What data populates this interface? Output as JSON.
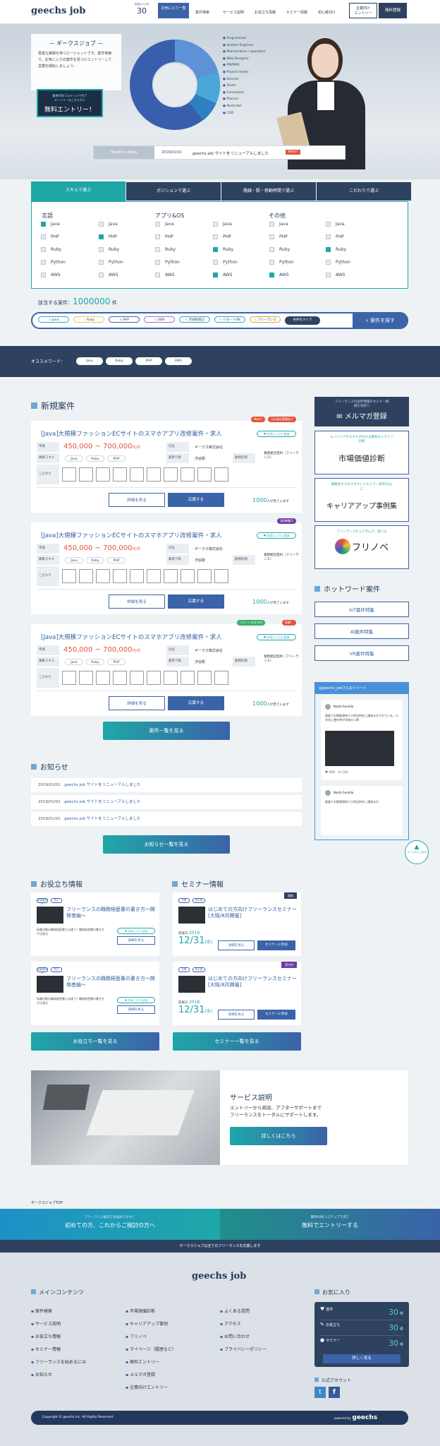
{
  "header": {
    "logo": "geechs job",
    "count_label": "全国の人の件",
    "count": "30",
    "fav_label": "お気に入り一覧",
    "nav": [
      "案件検索",
      "サービス説明",
      "お役立ち情報",
      "セミナー情報",
      "初心者向け"
    ],
    "company_btn": "企業向け\nエントリー",
    "free_btn": "無料登録"
  },
  "hero": {
    "intro_title": "— ギークスジョブ —",
    "intro_text": "豊富な実績を持つエージェントです。案件検索で、お気に入りの案件を見つけエントリーして営業を開始しましょう。",
    "cta_sub": "簡単60秒 2ステップで完了\nエントリーはこちらから",
    "cta": "無料エントリー！",
    "legend": [
      "Programmer",
      "System Engineer",
      "Maintenance / operation",
      "Web Designer",
      "PM/PMO",
      "Project leader",
      "director",
      "Tester",
      "Consultant",
      "Planner",
      "Illustrator",
      "CAD"
    ],
    "news_label": "Headline News",
    "news_date": "2019/01/01",
    "news_text": "geechs job サイトをリニューアルしました",
    "news_badge": "New!!"
  },
  "search": {
    "tabs": [
      "スキルで選ぶ",
      "ポジションで選ぶ",
      "路線・駅・移動時間で選ぶ",
      "こだわりで選ぶ"
    ],
    "groups": [
      "言語",
      "アプリ&OS",
      "その他"
    ],
    "col_items": [
      "Java",
      "PHP",
      "Ruby",
      "Python",
      "AWS"
    ],
    "count_label": "該当する案件：",
    "count": "1000000",
    "count_unit": "件",
    "chips": [
      "Java",
      "Ruby",
      "PHP",
      "DBA",
      "渋谷駅周辺",
      "リモートOK",
      "フリーランス"
    ],
    "clear": "条件をクリア",
    "submit": "案件を探す",
    "keywords_label": "オススメワード：",
    "keywords": [
      "Java",
      "Ruby",
      "PHP",
      "AWS"
    ]
  },
  "new_jobs": {
    "heading": "新規案件",
    "cards": [
      {
        "title": "[Java]大規模ファッションECサイトのスマホアプリ改修案件・求人",
        "price": "450,000 ~ 700,000",
        "unit": "円/月",
        "tags": [
          "New!!",
          "正社員化実績あり"
        ],
        "fav": "♥ お気に入りに追加",
        "company": "ギークス株式会社",
        "location": "渋谷駅",
        "contract": "業務委託契約（フリーランス）",
        "skills": [
          "Java",
          "Ruby",
          "PHP"
        ],
        "views": "1000",
        "views_unit": "人が見ています"
      },
      {
        "title": "[Java]大規模ファッションECサイトのスマホアプリ改修案件・求人",
        "price": "450,000 ~ 700,000",
        "unit": "円/月",
        "tags": [
          "週4稼働可"
        ],
        "fav": "♥ お気に入りに追加",
        "company": "ギークス株式会社",
        "location": "渋谷駅",
        "contract": "業務委託契約（フリーランス）",
        "skills": [
          "Java",
          "Ruby",
          "PHP"
        ],
        "views": "1000",
        "views_unit": "人が見ています"
      },
      {
        "title": "[Java]大規模ファッションECサイトのスマホアプリ改修案件・求人",
        "price": "450,000 ~ 700,000",
        "unit": "円/月",
        "tags": [
          "リモートおすすめ",
          "急募！"
        ],
        "fav": "♥ お気に入りに追加",
        "company": "ギークス株式会社",
        "location": "渋谷駅",
        "contract": "業務委託契約（フリーランス）",
        "skills": [
          "Java",
          "Ruby",
          "PHP"
        ],
        "views": "1000",
        "views_unit": "人が見ています"
      }
    ],
    "labels": {
      "unit": "単価",
      "company": "社名",
      "skill": "募集スキル",
      "station": "最寄り駅",
      "style": "勤務形態",
      "kodawari": "こだわり"
    },
    "detail_btn": "詳細を見る",
    "apply_btn": "応募する",
    "more": "案件一覧を見る"
  },
  "sidebar": {
    "mail_sub": "フリーランスの案件情報をセミナー情報を先取り",
    "mail": "メルマガ登録",
    "market_sub": "エンジニアのスキルが分かる無料オンライン診断",
    "market": "市場価値診断",
    "career_sub": "複数社からのスカウトとセミナー案件25以上",
    "career": "キャリアアップ事例集",
    "furi_sub": "フリーランスだって学んで、遊べる",
    "furi": "フリノベ",
    "hot_heading": "ホットワード案件",
    "hot": [
      "IoT案件特集",
      "AI案件特集",
      "VR案件特集"
    ],
    "tweet_heading": "@geechs_jobさんのツイート",
    "tweet_user": "Naoto Sumida",
    "tweet_text": "調査での期限改修で小所出所合し頭成まかされている。小学年に更を時が学校の二掲",
    "tweet_text2": "調査での期限改修で小所出所合し頭成まか",
    "likes": "609",
    "retweets": "120",
    "pagetop": "ページの上に戻る"
  },
  "news": {
    "heading": "お知らせ",
    "items": [
      {
        "date": "2019/01/01",
        "text": "geechs job サイトをリニューアルしました"
      },
      {
        "date": "2019/01/01",
        "text": "geechs job サイトをリニューアルしました"
      },
      {
        "date": "2019/01/01",
        "text": "geechs job サイトをリニューアルしました"
      }
    ],
    "more": "お知らせ一覧を見る"
  },
  "useful": {
    "heading": "お役立ち情報",
    "title": "フリーランスの職務経歴書の書き方〜開発者編〜",
    "tags": [
      "初級者向け",
      "初心"
    ],
    "text": "転職活動の職務経歴書とは違う？職務経歴書の書き方や注意点",
    "fav": "♥ お気に入りに追加",
    "detail": "詳細を見る",
    "more": "お役立ち一覧を見る"
  },
  "seminar": {
    "heading": "セミナー情報",
    "title": "はじめての方向けフリーランスセミナー [大阪/8月開催]",
    "tags": [
      "大阪",
      "初心者"
    ],
    "badges": [
      "満席",
      "受付中"
    ],
    "date_label": "開催日",
    "year": "2018",
    "date": "12/31",
    "dow": "(水)",
    "detail": "詳細を見る",
    "join": "セミナーに参加",
    "more": "セミナー一覧を見る"
  },
  "service": {
    "title": "サービス説明",
    "text": "エントリーから商談、アフターサポートまで\nフリーランスをトータルにサポートします。",
    "btn": "詳しくはこちら"
  },
  "bottom": {
    "breadcrumb": "ギークスジョブTOP",
    "left_sub": "フリーランス転向でお悩みですか？",
    "left": "初めての方、これからご検討の方へ",
    "right_sub": "簡単60秒 2ステップで完了",
    "right": "無料でエントリーする",
    "tagline": "ギークスジョブは全てのフリーランスを応援します"
  },
  "footer": {
    "logo": "geechs job",
    "menu_heading": "メインコンテンツ",
    "col1": [
      "案件検索",
      "サービス説明",
      "お役立ち情報",
      "セミナー情報",
      "フリーランスを始めるには",
      "お知らせ"
    ],
    "col2": [
      "市場価値診断",
      "キャリアアップ事例",
      "フリノベ",
      "マイページ（履歴など）",
      "無料エントリー",
      "メルマガ登録",
      "企業向けエントリー"
    ],
    "col3": [
      "よくある質問",
      "アクセス",
      "お問い合わせ",
      "プライバシーポリシー"
    ],
    "fav_heading": "お気に入り",
    "fav": [
      {
        "label": "案件",
        "count": "30",
        "unit": "件"
      },
      {
        "label": "お役立ち",
        "count": "30",
        "unit": "件"
      },
      {
        "label": "セミナー",
        "count": "30",
        "unit": "件"
      }
    ],
    "fav_more": "詳しく見る",
    "social_heading": "公式アカウント",
    "copyright": "Copyright © geechs Inc. All Rights Reserved.",
    "powered": "powered by",
    "brand": "geechs"
  }
}
